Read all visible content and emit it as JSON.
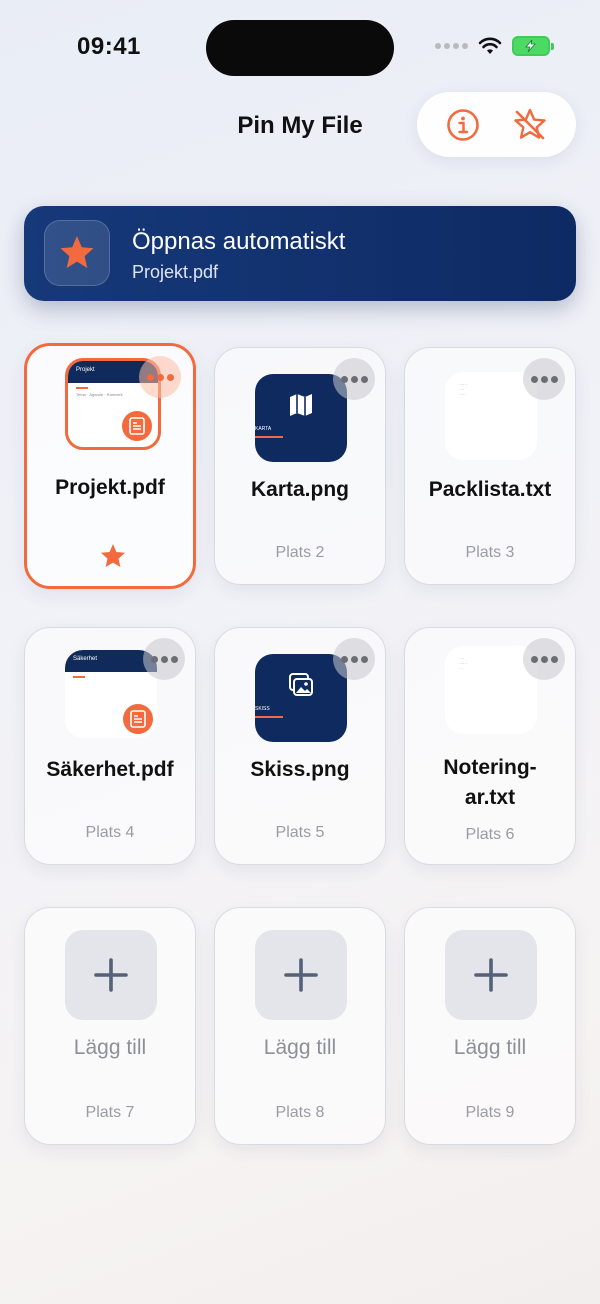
{
  "status": {
    "time": "09:41"
  },
  "header": {
    "title": "Pin My File"
  },
  "banner": {
    "title": "Öppnas automatiskt",
    "subtitle": "Projekt.pdf"
  },
  "slots": [
    {
      "name": "Projekt.pdf",
      "slot_label": "",
      "thumb_title": "Projekt",
      "thumb_text": "Tema · Ägande · Ramverk",
      "type": "pdf",
      "favorite": true
    },
    {
      "name": "Karta.png",
      "slot_label": "Plats 2",
      "thumb_caption": "KARTA",
      "type": "image"
    },
    {
      "name": "Packlista.txt",
      "slot_label": "Plats 3",
      "type": "text"
    },
    {
      "name": "Säkerhet.pdf",
      "slot_label": "Plats 4",
      "thumb_title": "Säkerhet",
      "type": "pdf"
    },
    {
      "name": "Skiss.png",
      "slot_label": "Plats 5",
      "thumb_caption": "SKISS",
      "type": "image"
    },
    {
      "name": "Notering-",
      "name2": "ar.txt",
      "slot_label": "Plats 6",
      "type": "text"
    },
    {
      "add_label": "Lägg till",
      "slot_label": "Plats 7",
      "type": "empty"
    },
    {
      "add_label": "Lägg till",
      "slot_label": "Plats 8",
      "type": "empty"
    },
    {
      "add_label": "Lägg till",
      "slot_label": "Plats 9",
      "type": "empty"
    }
  ],
  "colors": {
    "accent": "#f26a3d",
    "navy": "#0f2a5e"
  },
  "icons": {
    "info": "info-icon",
    "unpin": "star-slash-icon",
    "more": "more-icon",
    "add": "plus-icon",
    "favorite": "star-icon"
  }
}
